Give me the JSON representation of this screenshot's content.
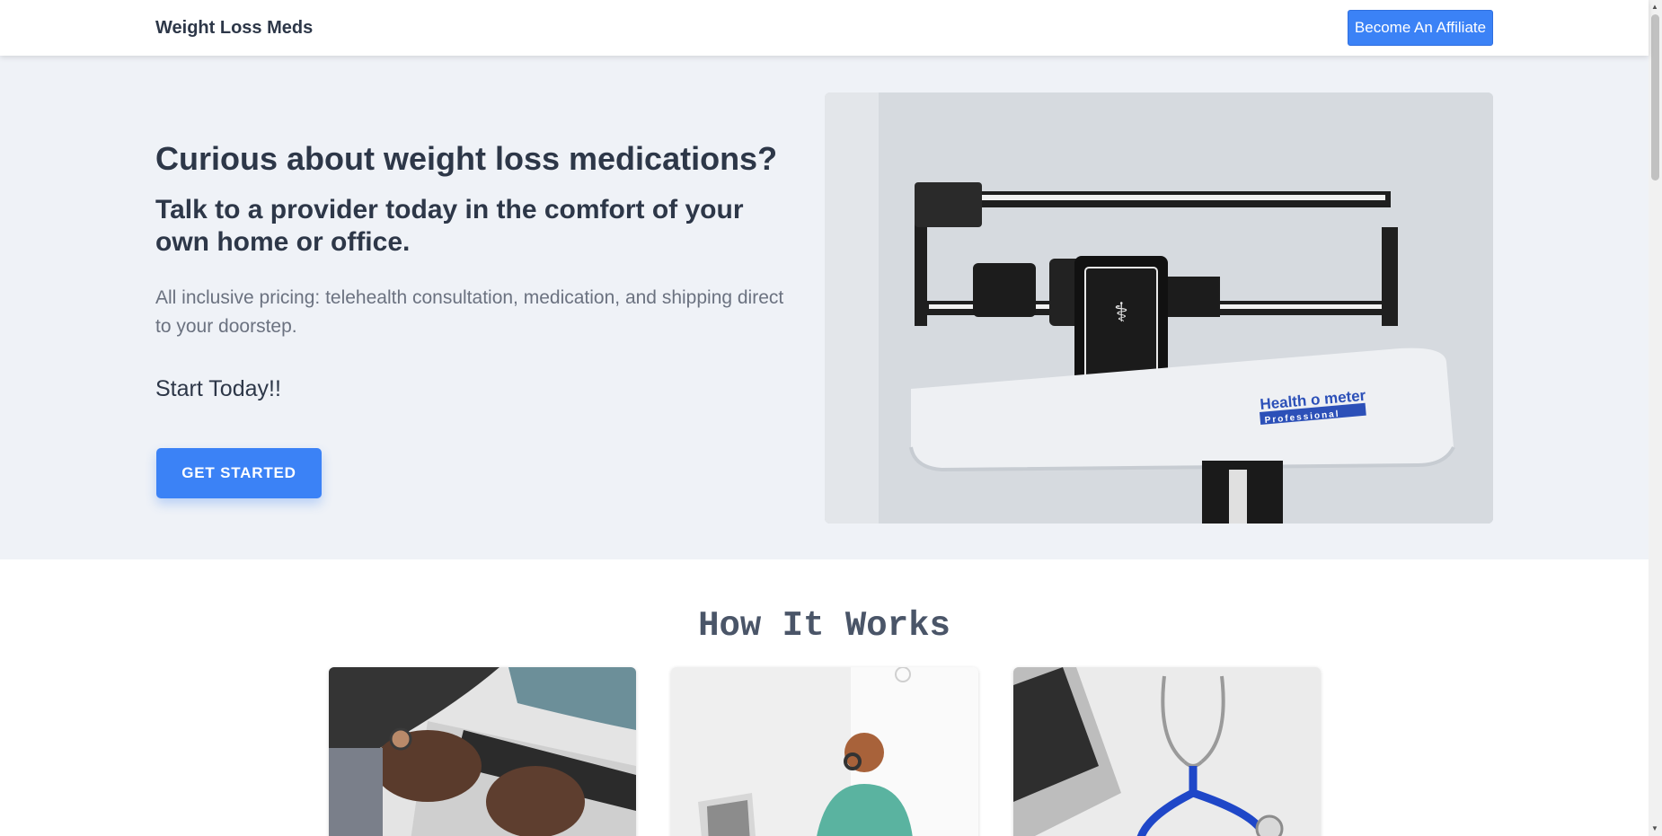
{
  "navbar": {
    "brand": "Weight Loss Meds",
    "affiliate_button": "Become An Affiliate"
  },
  "hero": {
    "title": "Curious about weight loss medications?",
    "subtitle": "Talk to a provider today in the comfort of your own home or office.",
    "description": "All inclusive pricing: telehealth consultation, medication, and shipping direct to your doorstep.",
    "cta_text": "Start Today!!",
    "cta_button": "GET STARTED",
    "image_brand_text": "Health o meter",
    "image_sub_text": "Professional"
  },
  "how_it_works": {
    "title": "How It Works"
  },
  "colors": {
    "accent": "#3b82f6",
    "hero_bg": "#eff2f7",
    "text_dark": "#2d3748",
    "text_muted": "#6b7280"
  }
}
